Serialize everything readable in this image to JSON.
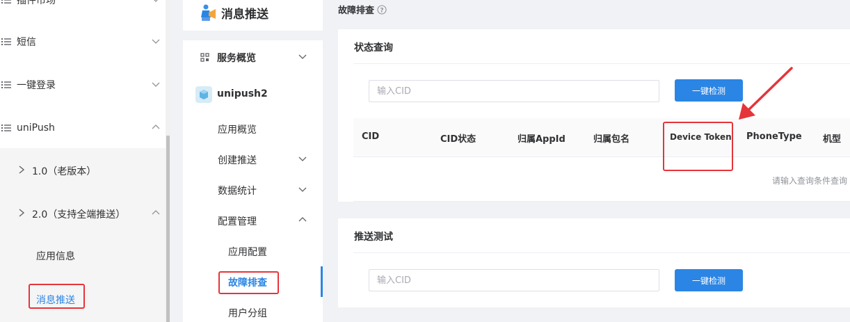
{
  "sidebar": {
    "items": [
      {
        "label": "插件市场"
      },
      {
        "label": "短信"
      },
      {
        "label": "一键登录"
      },
      {
        "label": "uniPush"
      }
    ],
    "sub_items": [
      {
        "label": "1.0（老版本）"
      },
      {
        "label": "2.0（支持全端推送）"
      }
    ],
    "leaves": [
      {
        "label": "应用信息"
      },
      {
        "label": "消息推送"
      }
    ]
  },
  "nav": {
    "title": "消息推送",
    "overview": "服务概览",
    "app": "unipush2",
    "items": [
      {
        "label": "应用概览"
      },
      {
        "label": "创建推送"
      },
      {
        "label": "数据统计"
      },
      {
        "label": "配置管理"
      },
      {
        "label": "应用配置"
      },
      {
        "label": "故障排查"
      },
      {
        "label": "用户分组"
      }
    ]
  },
  "content": {
    "breadcrumb": "故障排查",
    "status_card": {
      "title": "状态查询",
      "input_placeholder": "输入CID",
      "button": "一键检测",
      "columns": [
        "CID",
        "CID状态",
        "归属AppId",
        "归属包名",
        "Device Token",
        "PhoneType",
        "机型"
      ],
      "empty_text": "请输入查询条件查询"
    },
    "push_card": {
      "title": "推送测试",
      "input_placeholder": "输入CID",
      "button": "一键检测"
    }
  },
  "colors": {
    "primary": "#2b85e4",
    "highlight": "#e5343a",
    "active_text": "#2b85e4"
  }
}
